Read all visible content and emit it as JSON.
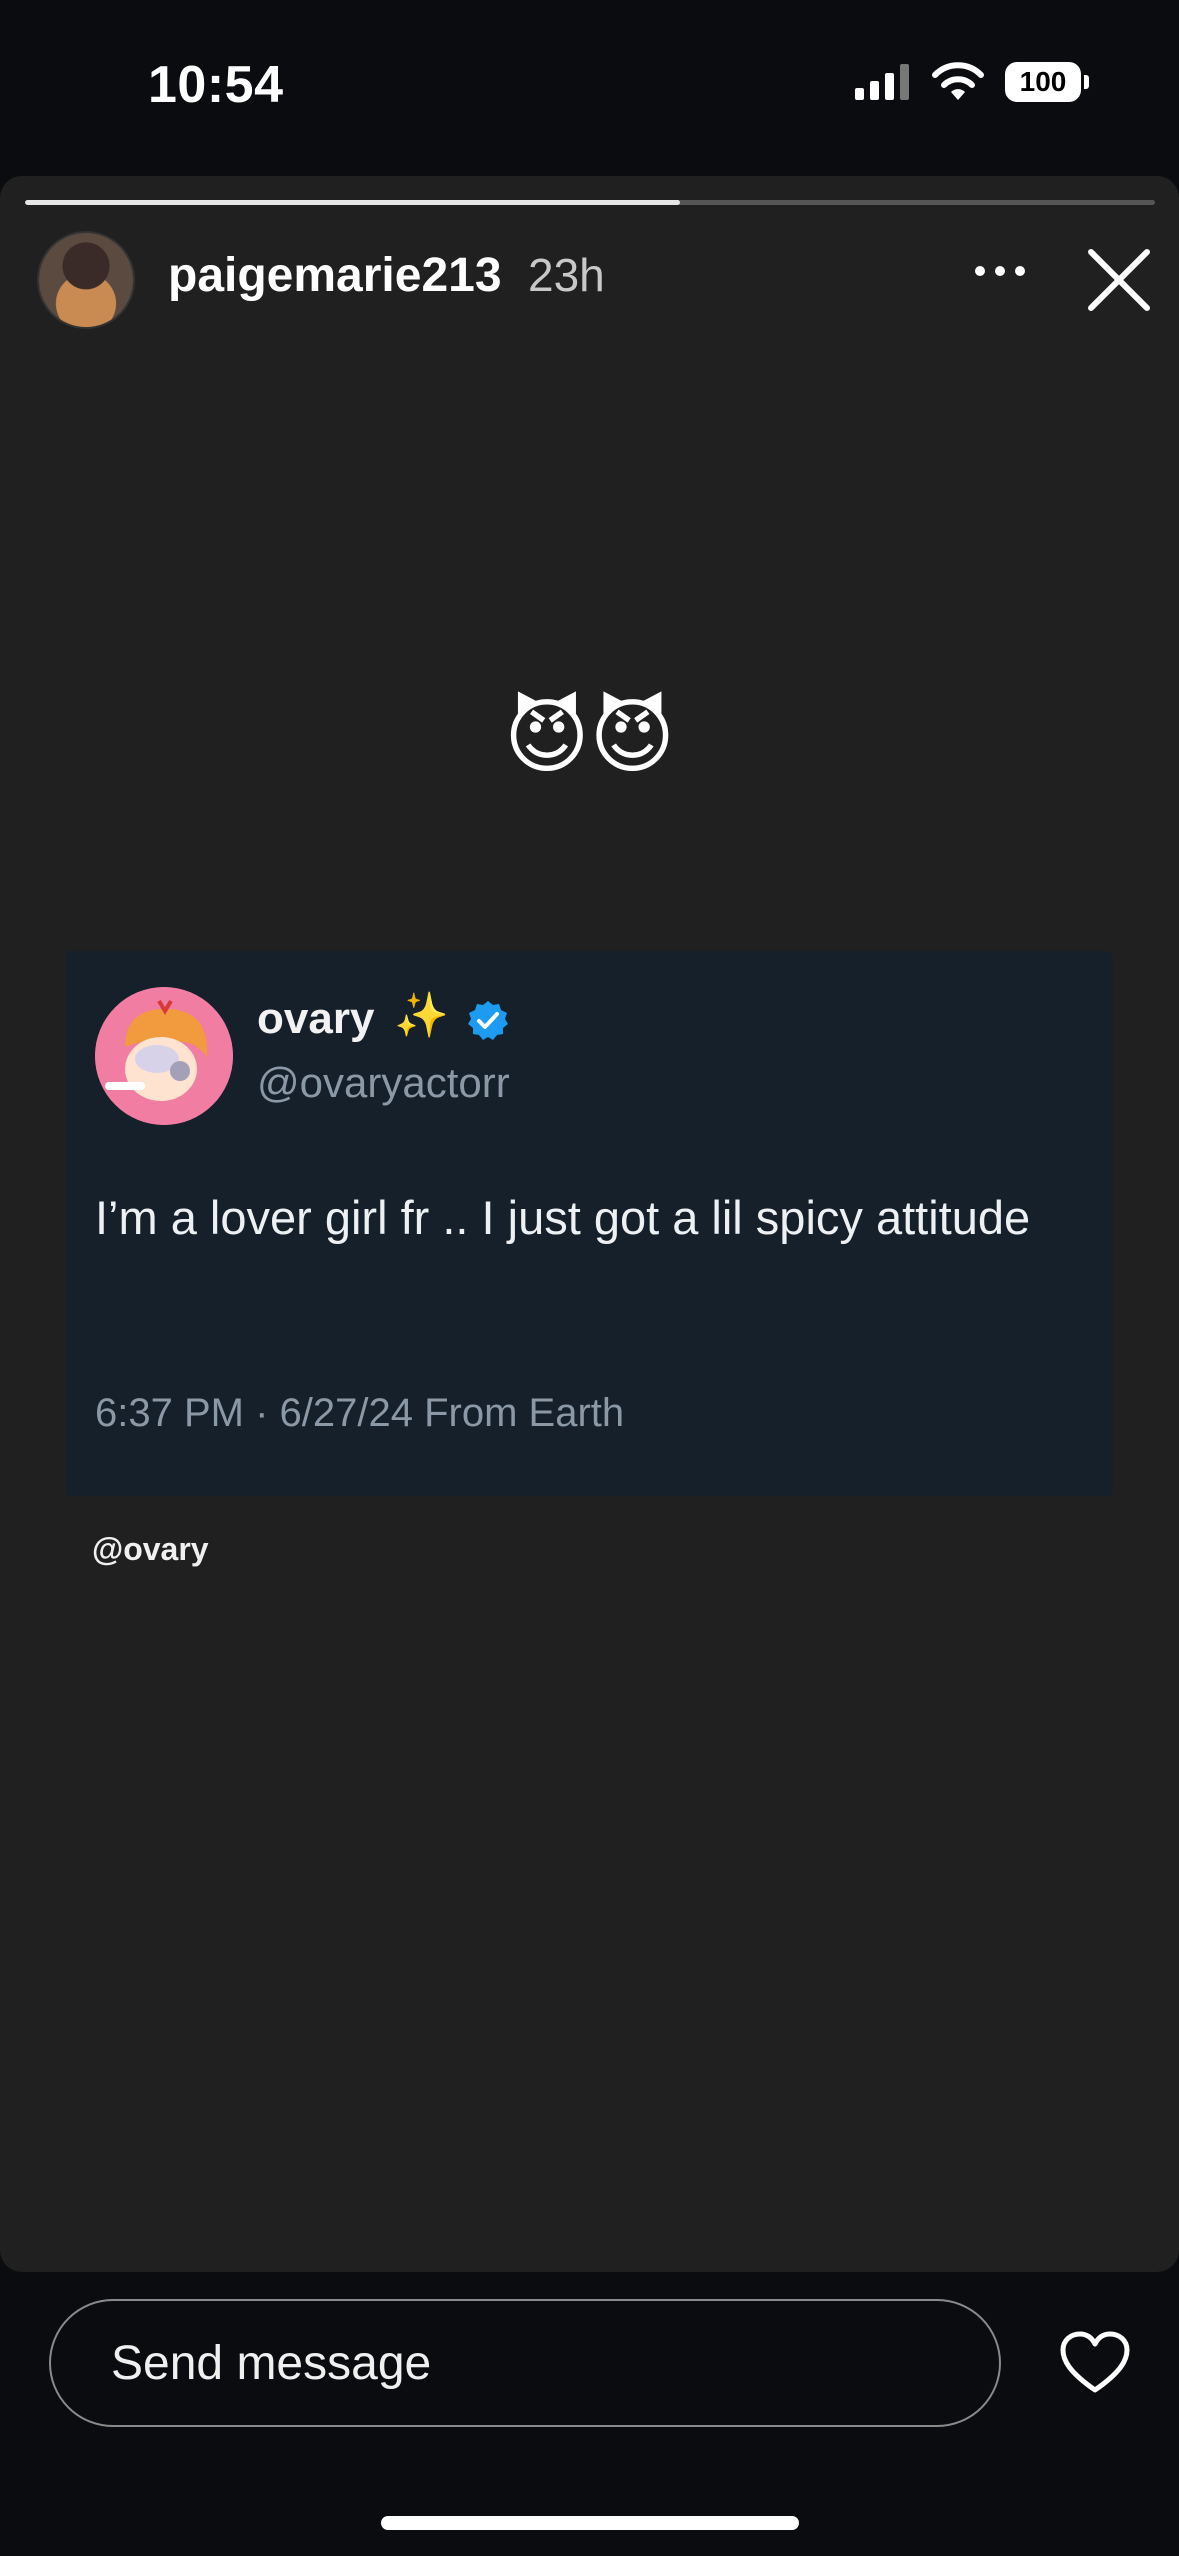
{
  "status_bar": {
    "time": "10:54",
    "battery": "100"
  },
  "story": {
    "progress": 0.58,
    "username": "paigemarie213",
    "time_ago": "23h",
    "emoji_text": "😈😈"
  },
  "tweet": {
    "display_name": "ovary",
    "sparkles": "✨",
    "handle": "@ovaryactorr",
    "text": "I’m a lover girl fr .. I just got a lil spicy attitude",
    "meta": "6:37 PM · 6/27/24 From Earth"
  },
  "mention": "@ovary",
  "reply": {
    "placeholder": "Send message"
  },
  "colors": {
    "story_bg": "#202020",
    "tweet_bg": "#15202b",
    "verified": "#1d9bf0"
  }
}
